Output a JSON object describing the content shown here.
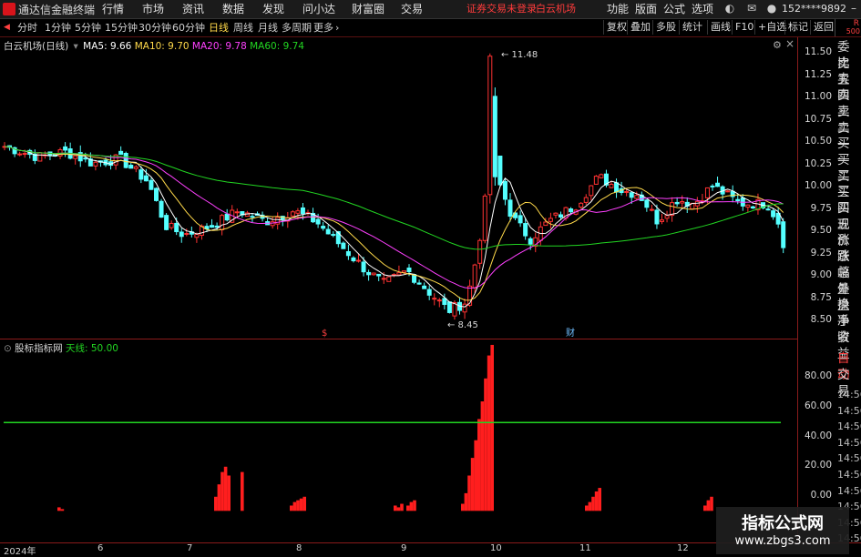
{
  "app": {
    "title": "通达信金融终端"
  },
  "menu": [
    "行情",
    "市场",
    "资讯",
    "数据",
    "发现",
    "问小达",
    "财富圈",
    "交易"
  ],
  "warning": "证券交易未登录",
  "stock_name_header": "白云机场",
  "right_menu": [
    "功能",
    "版面",
    "公式",
    "选项"
  ],
  "phone": "152****9892",
  "periods": [
    "分时",
    "1分钟",
    "5分钟",
    "15分钟",
    "30分钟",
    "60分钟",
    "日线",
    "周线",
    "月线",
    "多周期",
    "更多"
  ],
  "active_period": "日线",
  "toolbar_right": [
    "复权",
    "叠加",
    "多股",
    "统计",
    "画线",
    "F10",
    "+自选",
    "标记",
    "返回"
  ],
  "badge": {
    "r": "R",
    "n": "500"
  },
  "main_legend": {
    "title": "白云机场(日线)",
    "ma5": "MA5: 9.66",
    "ma10": "MA10: 9.70",
    "ma20": "MA20: 9.78",
    "ma60": "MA60: 9.74"
  },
  "indicator_legend": {
    "title": "股标指标网",
    "line": "天线: 50.00"
  },
  "price_axis": [
    "11.50",
    "11.25",
    "11.00",
    "10.75",
    "10.50",
    "10.25",
    "10.00",
    "9.75",
    "9.50",
    "9.25",
    "9.00",
    "8.75",
    "8.50"
  ],
  "indicator_axis": [
    "80.00",
    "60.00",
    "40.00",
    "20.00",
    "0.00"
  ],
  "annotations": {
    "high": "11.48",
    "low": "8.45",
    "marker1": "$",
    "marker2": "财"
  },
  "side_panel": [
    "委比",
    "卖五",
    "卖四",
    "卖三",
    "卖二",
    "卖一",
    "买一",
    "买二",
    "买三",
    "买四",
    "买五",
    "现价",
    "涨跌",
    "涨幅",
    "总量",
    "外盘",
    "换手",
    "净资",
    "收益"
  ],
  "side_panel2": [
    "自动",
    "交易"
  ],
  "side_times": [
    "14:56",
    "14:56",
    "14:56",
    "14:56",
    "14:56",
    "14:56",
    "14:56",
    "14:56",
    "14:56",
    "14:56"
  ],
  "date_axis": [
    "2024年",
    "6",
    "7",
    "8",
    "9",
    "10",
    "11",
    "12"
  ],
  "watermark": {
    "title": "指标公式网",
    "url": "www.zbgs3.com"
  },
  "colors": {
    "up": "#ff3232",
    "down": "#54ffff",
    "ma5": "#ffffff",
    "ma10": "#ffd94a",
    "ma20": "#ff40ff",
    "ma60": "#22d622",
    "indicator_line": "#22d622",
    "indicator_bar": "#ff1e1e"
  },
  "chart_data": {
    "type": "candlestick",
    "price_series": [
      {
        "name": "MA5",
        "value_last": 9.66
      },
      {
        "name": "MA10",
        "value_last": 9.7
      },
      {
        "name": "MA20",
        "value_last": 9.78
      },
      {
        "name": "MA60",
        "value_last": 9.74
      }
    ],
    "ylim": [
      8.4,
      11.6
    ],
    "indicator": {
      "name": "天线",
      "line_value": 50.0,
      "ylim": [
        -5,
        95
      ],
      "bar_groups": [
        {
          "start": 63,
          "values": [
            2,
            1
          ]
        },
        {
          "start": 235,
          "values": [
            8,
            15,
            22,
            25,
            20
          ]
        },
        {
          "start": 264,
          "values": [
            22
          ]
        },
        {
          "start": 318,
          "values": [
            3,
            5,
            6,
            7,
            8
          ]
        },
        {
          "start": 432,
          "values": [
            3,
            2,
            4
          ]
        },
        {
          "start": 446,
          "values": [
            3,
            5,
            6
          ]
        },
        {
          "start": 506,
          "values": [
            4,
            10,
            20,
            30,
            40,
            52,
            62,
            75,
            88,
            94
          ]
        },
        {
          "start": 642,
          "values": [
            3,
            5,
            8,
            11,
            13
          ]
        },
        {
          "start": 772,
          "values": [
            3,
            6,
            8
          ]
        }
      ]
    }
  }
}
